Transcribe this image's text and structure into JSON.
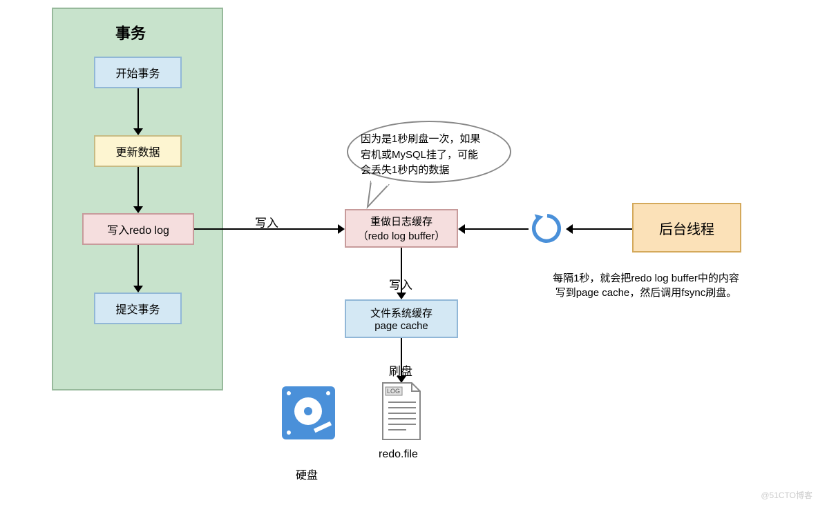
{
  "transaction": {
    "title": "事务",
    "steps": {
      "begin": "开始事务",
      "update": "更新数据",
      "writeRedo": "写入redo log",
      "commit": "提交事务"
    }
  },
  "labels": {
    "writeTo": "写入",
    "writeTo2": "写入",
    "flush": "刷盘"
  },
  "redoBuffer": {
    "line1": "重做日志缓存",
    "line2": "（redo log buffer）"
  },
  "pageCache": {
    "line1": "文件系统缓存",
    "line2": "page cache"
  },
  "bgThread": {
    "label": "后台线程",
    "note1": "每隔1秒，就会把redo log buffer中的内容",
    "note2": "写到page cache，然后调用fsync刷盘。"
  },
  "bubble": {
    "line1": "因为是1秒刷盘一次，如果",
    "line2": "宕机或MySQL挂了，可能",
    "line3": "会丢失1秒内的数据"
  },
  "disk": {
    "label": "硬盘",
    "fileLabel": "redo.file",
    "logBadge": "LOG"
  },
  "watermark": "@51CTO博客"
}
